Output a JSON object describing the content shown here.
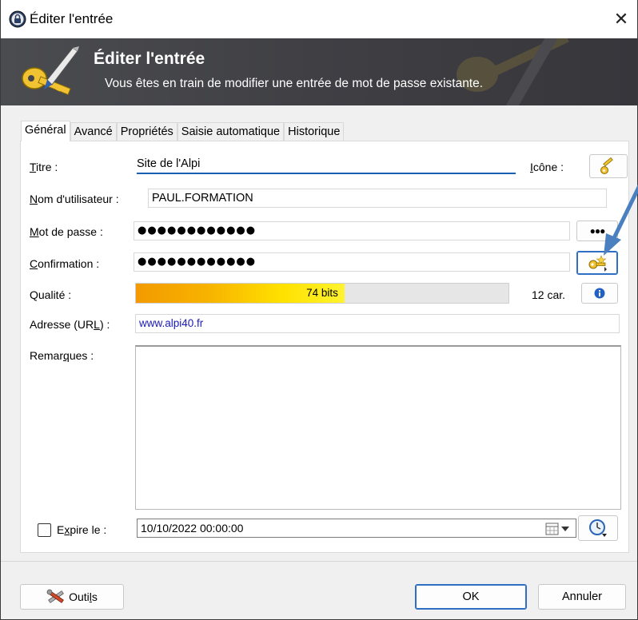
{
  "window": {
    "title": "Éditer l'entrée",
    "close_glyph": "✕",
    "app_icon": "keepass-lock-icon"
  },
  "banner": {
    "title": "Éditer l'entrée",
    "subtitle": "Vous êtes en train de modifier une entrée de mot de passe existante."
  },
  "tabs": [
    {
      "label": "Général",
      "active": true
    },
    {
      "label": "Avancé",
      "active": false
    },
    {
      "label": "Propriétés",
      "active": false
    },
    {
      "label": "Saisie automatique",
      "active": false
    },
    {
      "label": "Historique",
      "active": false
    }
  ],
  "form": {
    "title_label_u": "T",
    "title_label_rest": "itre :",
    "title_value": "Site de l'Alpi",
    "icon_label_u": "I",
    "icon_label_rest": "cône :",
    "username_label_u": "N",
    "username_label_rest": "om d'utilisateur :",
    "username_value": "PAUL.FORMATION",
    "password_label_u": "M",
    "password_label_rest": "ot de passe :",
    "password_value": "●●●●●●●●●●●●",
    "show_password_glyph": "●●●",
    "confirm_label_u": "C",
    "confirm_label_rest": "onfirmation :",
    "confirm_value": "●●●●●●●●●●●●",
    "quality_label": "Qualité :",
    "quality_bits": "74 bits",
    "quality_fraction": 0.56,
    "char_count": "12 car.",
    "url_label_pre": "Adresse (UR",
    "url_label_u": "L",
    "url_label_post": ") :",
    "url_value": "www.alpi40.fr",
    "notes_label_pre": "Remar",
    "notes_label_u": "q",
    "notes_label_post": "ues :",
    "notes_value": "",
    "expires_label_pre": "E",
    "expires_label_u": "x",
    "expires_label_post": "pire le :",
    "expires_checked": false,
    "expires_value": "10/10/2022 00:00:00"
  },
  "footer": {
    "tools_label_pre": "Outi",
    "tools_label_u": "l",
    "tools_label_post": "s",
    "ok_label": "OK",
    "cancel_label": "Annuler"
  },
  "colors": {
    "banner_bg": "#45464a",
    "accent_blue": "#2e6fc4",
    "url_text": "#1a1ab8",
    "quality_start": "#f39a00",
    "quality_end": "#fff330"
  }
}
